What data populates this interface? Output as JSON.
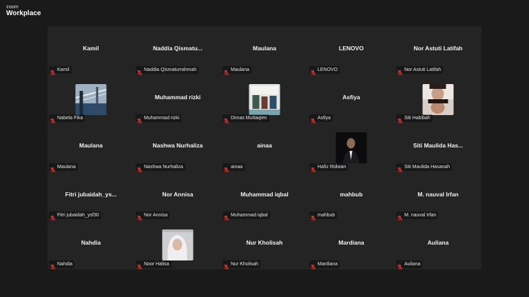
{
  "app": {
    "brand_top": "zoom",
    "brand_bottom": "Workplace"
  },
  "tiles": [
    {
      "display": "Kamil",
      "label": "Kamil",
      "video": false
    },
    {
      "display": "Naddia  Qismatu...",
      "label": "Naddia Qismaturrahmah",
      "video": false
    },
    {
      "display": "Maulana",
      "label": "Maulana",
      "video": false
    },
    {
      "display": "LENOVO",
      "label": "LENOVO",
      "video": false
    },
    {
      "display": "Nor Astuti Latifah",
      "label": "Nor Astuti Latifah",
      "video": false
    },
    {
      "display": "",
      "label": "Nabela Fika",
      "video": true,
      "thumb": "railing"
    },
    {
      "display": "Muhammad rizki",
      "label": "Muhammad rizki",
      "video": false
    },
    {
      "display": "",
      "label": "Dimas Muttaqien",
      "video": true,
      "thumb": "poster"
    },
    {
      "display": "Asfiya",
      "label": "Asfiya",
      "video": false
    },
    {
      "display": "",
      "label": "Siti Habibah",
      "video": true,
      "thumb": "faces"
    },
    {
      "display": "Maulana",
      "label": "Maulana",
      "video": false
    },
    {
      "display": "Nashwa Nurhaliza",
      "label": "Nashwa Nurhaliza",
      "video": false
    },
    {
      "display": "ainaa",
      "label": "ainaa",
      "video": false
    },
    {
      "display": "",
      "label": "Hafiz Ridwan",
      "video": true,
      "thumb": "portrait"
    },
    {
      "display": "Siti  Maulida  Has...",
      "label": "Siti Maulida Hasanah",
      "video": false
    },
    {
      "display": "Fitri  jubaidah_ys...",
      "label": "Fitri jubaidah_ysf30",
      "video": false
    },
    {
      "display": "Nor Annisa",
      "label": "Nor Annisa",
      "video": false
    },
    {
      "display": "Muhammad iqbal",
      "label": "Muhammad iqbal",
      "video": false
    },
    {
      "display": "mahbub",
      "label": "mahbub",
      "video": false
    },
    {
      "display": "M. nauval Irfan",
      "label": "M. nauval Irfan",
      "video": false
    },
    {
      "display": "Nahdia",
      "label": "Nahdia",
      "video": false
    },
    {
      "display": "",
      "label": "Noor Halisa",
      "video": true,
      "thumb": "hijab"
    },
    {
      "display": "Nur Kholisah",
      "label": "Nur Kholisah",
      "video": false
    },
    {
      "display": "Mardiana",
      "label": "Mardiana",
      "video": false
    },
    {
      "display": "Auliana",
      "label": "Auliana",
      "video": false
    }
  ],
  "colors": {
    "muted_mic": "#e02828",
    "gallery_bg": "#242424",
    "page_bg": "#1a1a1a"
  },
  "icons": {
    "mic": "muted-mic-icon"
  }
}
